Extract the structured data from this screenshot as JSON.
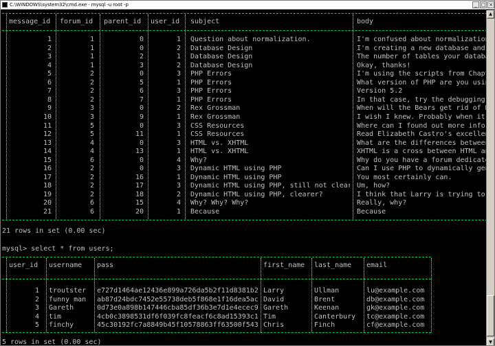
{
  "window": {
    "title": "C:\\WINDOWS\\system32\\cmd.exe - mysql -u root -p",
    "controls": [
      "_",
      "□",
      "×"
    ]
  },
  "messages_table": {
    "columns": [
      "message_id",
      "forum_id",
      "parent_id",
      "user_id",
      "subject",
      "body"
    ],
    "rows": [
      [
        "1",
        "1",
        "0",
        "1",
        "Question about normalization.",
        "I'm confused about normalization."
      ],
      [
        "2",
        "1",
        "0",
        "2",
        "Database Design",
        "I'm creating a new database and a"
      ],
      [
        "3",
        "1",
        "2",
        "1",
        "Database Design",
        "The number of tables your databas"
      ],
      [
        "4",
        "1",
        "3",
        "2",
        "Database Design",
        "Okay, thanks!"
      ],
      [
        "5",
        "2",
        "0",
        "3",
        "PHP Errors",
        "I'm using the scripts from Chapte"
      ],
      [
        "6",
        "2",
        "5",
        "1",
        "PHP Errors",
        "What version of PHP are you using"
      ],
      [
        "7",
        "2",
        "6",
        "3",
        "PHP Errors",
        "Version 5.2"
      ],
      [
        "8",
        "2",
        "7",
        "1",
        "PHP Errors",
        "In that case, try the debugging s"
      ],
      [
        "9",
        "3",
        "0",
        "2",
        "Rex Grossman",
        "When will the Bears get rid of Re"
      ],
      [
        "10",
        "3",
        "9",
        "1",
        "Rex Grossman",
        "I wish I knew. Probably when it's"
      ],
      [
        "11",
        "5",
        "0",
        "3",
        "CSS Resources",
        "Where can I found out more inform"
      ],
      [
        "12",
        "5",
        "11",
        "1",
        "CSS Resources",
        "Read Elizabeth Castro's excellent"
      ],
      [
        "13",
        "4",
        "0",
        "3",
        "HTML vs. XHTML",
        "What are the differences between"
      ],
      [
        "14",
        "4",
        "13",
        "1",
        "HTML vs. XHTML",
        "XHTML is a cross between HTML and"
      ],
      [
        "15",
        "6",
        "0",
        "4",
        "Why?",
        "Why do you have a forum dedicated"
      ],
      [
        "16",
        "2",
        "0",
        "3",
        "Dynamic HTML using PHP",
        "Can I use PHP to dynamically gene"
      ],
      [
        "17",
        "2",
        "16",
        "1",
        "Dynamic HTML using PHP",
        "You most certainly can."
      ],
      [
        "18",
        "2",
        "17",
        "3",
        "Dynamic HTML using PHP, still not clear",
        "Um, how?"
      ],
      [
        "19",
        "2",
        "18",
        "2",
        "Dynamic HTML using PHP, clearer?",
        "I think that Larry is trying to s"
      ],
      [
        "20",
        "6",
        "15",
        "4",
        "Why? Why? Why?",
        "Really, why?"
      ],
      [
        "21",
        "6",
        "20",
        "1",
        "Because",
        "Because"
      ]
    ],
    "footer": "21 rows in set (0.00 sec)"
  },
  "prompt_line": "mysql> select * from users;",
  "users_table": {
    "columns": [
      "user_id",
      "username",
      "pass",
      "first_name",
      "last_name",
      "email"
    ],
    "rows": [
      [
        "1",
        "troutster",
        "e727d1464ae12436e899a726da5b2f11d8381b26",
        "Larry",
        "Ullman",
        "lu@example.com"
      ],
      [
        "2",
        "funny man",
        "ab87d24bdc7452e55738deb5f868e1f16dea5ace",
        "David",
        "Brent",
        "db@example.com"
      ],
      [
        "3",
        "Gareth",
        "0d73e0a898b147446cba85df36b3e7d1e4ecec97",
        "Gareth",
        "Keenan",
        "gk@example.com"
      ],
      [
        "4",
        "tim",
        "4cb0c3898531df6f039fc8feacf6c8ad15393c1",
        "Tim",
        "Canterbury",
        "tc@example.com"
      ],
      [
        "5",
        "finchy",
        "45c30192fc7a8849b45f10578863ff63500f5431",
        "Chris",
        "Finch",
        "cf@example.com"
      ]
    ],
    "footer": "5 rows in set (0.00 sec)"
  },
  "colors": {
    "background": "#000000",
    "text": "#c0c0c0",
    "border": "#00cc66"
  }
}
